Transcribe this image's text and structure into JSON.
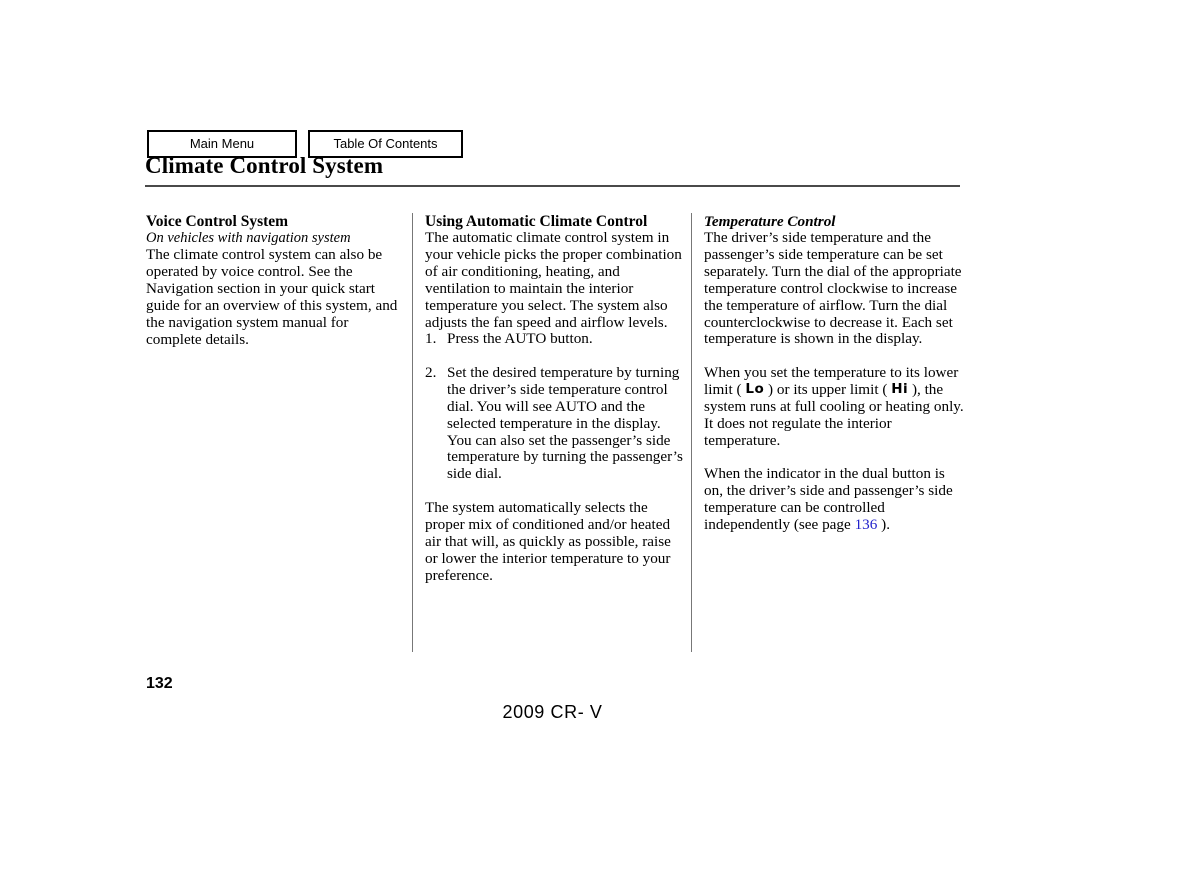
{
  "nav": {
    "main_menu_label": "Main Menu",
    "table_of_contents_label": "Table Of Contents"
  },
  "header": {
    "title": "Climate Control System"
  },
  "columns": [
    {
      "heading": "Voice Control System",
      "subheading": "On vehicles with navigation system",
      "paragraphs": [
        "The climate control system can also be operated by voice control. See the Navigation section in your quick start guide for an overview of this system, and the navigation system manual for complete details."
      ]
    },
    {
      "heading": "Using Automatic Climate Control",
      "intro": "The automatic climate control system in your vehicle picks the proper combination of air conditioning, heating, and ventilation to maintain the interior temperature you select. The system also adjusts the fan speed and airflow levels.",
      "steps": [
        {
          "number": "1.",
          "text": "Press the AUTO button."
        },
        {
          "number": "2.",
          "text": "Set the desired temperature by turning the driver’s side temperature control dial. You will see AUTO and the selected temperature in the display. You can also set the passenger’s side temperature by turning the passenger’s side dial."
        }
      ],
      "closing": "The system automatically selects the proper mix of conditioned and/or heated air that will, as quickly as possible, raise or lower the interior temperature to your preference."
    },
    {
      "heading": "Temperature Control",
      "paragraph_1": "The driver’s side temperature and the passenger’s side temperature can be set separately. Turn the dial of the appropriate temperature control clockwise to increase the temperature of airflow. Turn the dial counterclockwise to decrease it. Each set temperature is shown in the display.",
      "paragraph_2": {
        "part_1": "When you set the temperature to its lower limit ( ",
        "lo_symbol": "Lo",
        "part_2": " ) or its upper limit ( ",
        "hi_symbol": "Hi",
        "part_3": " ), the system runs at full cooling or heating only. It does not regulate the interior temperature."
      },
      "paragraph_3": {
        "part_1": "When the indicator in the dual button is on, the driver’s side and passenger’s side temperature can be controlled independently (see page ",
        "page_ref": "136",
        "part_2": " )."
      }
    }
  ],
  "footer": {
    "page_number": "132",
    "document_label": "2009  CR- V"
  },
  "colors": {
    "link": "#2222cc",
    "rule": "#4a4a4a",
    "divider": "#777777",
    "text": "#000000",
    "background": "#ffffff"
  }
}
